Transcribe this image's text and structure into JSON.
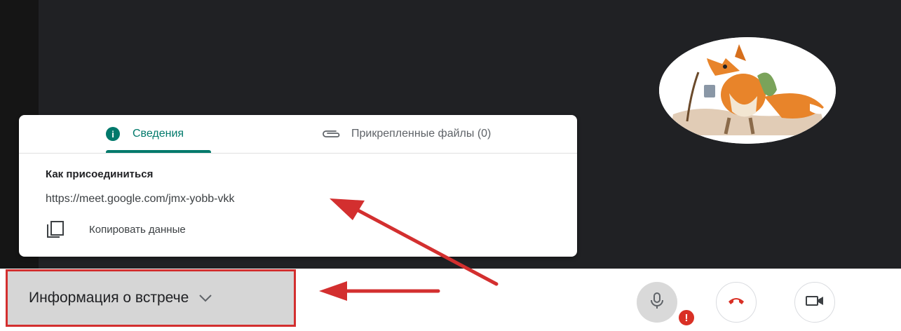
{
  "colors": {
    "video_background": "#202124",
    "accent": "#00796b",
    "annotation_red": "#d32f2f",
    "hangup_red": "#d93025"
  },
  "details_panel": {
    "tabs": [
      {
        "label": "Сведения",
        "icon": "info-icon",
        "active": true
      },
      {
        "label": "Прикрепленные файлы (0)",
        "icon": "paperclip-icon",
        "active": false
      }
    ],
    "join_title": "Как присоединиться",
    "meet_link": "https://meet.google.com/jmx-yobb-vkk",
    "copy_label": "Копировать данные",
    "copy_icon": "copy-icon"
  },
  "bottom_bar": {
    "meeting_info_label": "Информация о встрече",
    "meeting_info_icon": "chevron-down-icon",
    "controls": [
      {
        "name": "microphone",
        "icon": "microphone-icon",
        "badge": "!"
      },
      {
        "name": "hang-up",
        "icon": "phone-hangup-icon"
      },
      {
        "name": "camera",
        "icon": "video-camera-icon"
      }
    ]
  },
  "participant": {
    "avatar": "fox-avatar"
  }
}
